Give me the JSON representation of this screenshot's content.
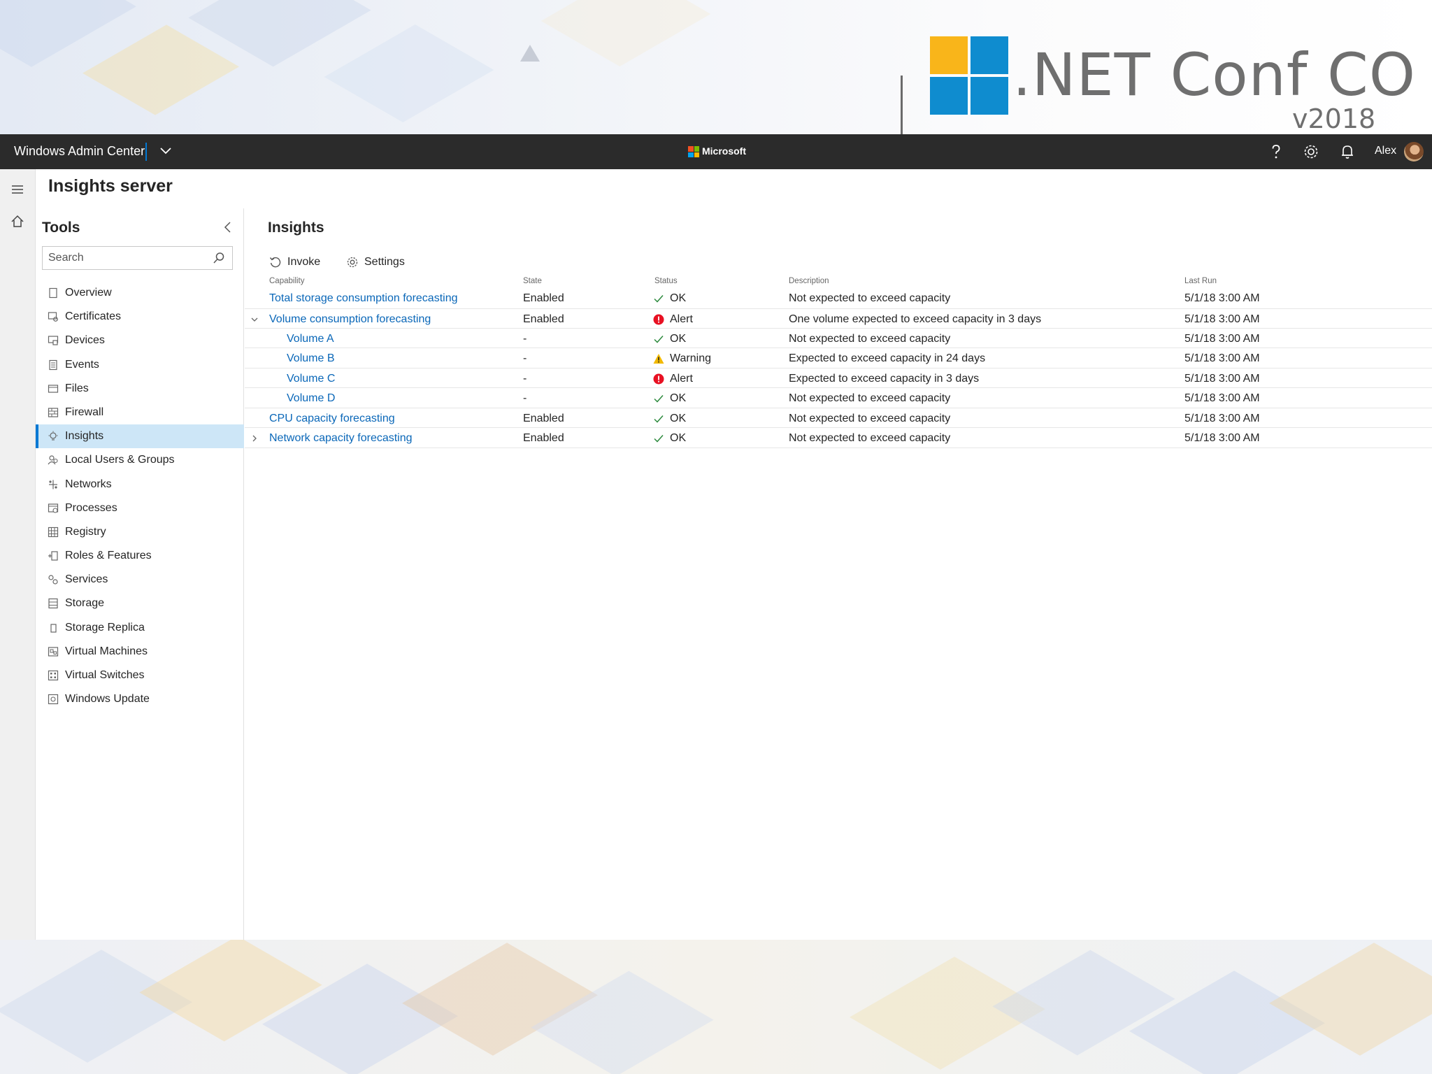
{
  "conference": {
    "title": ".NET Conf CO",
    "version": "v2018"
  },
  "topbar": {
    "app_title": "Windows Admin Center",
    "brand": "Microsoft",
    "user": "Alex",
    "icons": [
      "chevron-down-icon",
      "help-icon",
      "gear-icon",
      "bell-icon",
      "avatar"
    ]
  },
  "server": {
    "title": "Insights server"
  },
  "tools": {
    "title": "Tools",
    "search_placeholder": "Search",
    "items": [
      {
        "label": "Overview",
        "icon": "overview-icon"
      },
      {
        "label": "Certificates",
        "icon": "certificates-icon"
      },
      {
        "label": "Devices",
        "icon": "devices-icon"
      },
      {
        "label": "Events",
        "icon": "events-icon"
      },
      {
        "label": "Files",
        "icon": "files-icon"
      },
      {
        "label": "Firewall",
        "icon": "firewall-icon"
      },
      {
        "label": "Insights",
        "icon": "insights-icon",
        "active": true
      },
      {
        "label": "Local Users & Groups",
        "icon": "users-icon"
      },
      {
        "label": "Networks",
        "icon": "networks-icon"
      },
      {
        "label": "Processes",
        "icon": "processes-icon"
      },
      {
        "label": "Registry",
        "icon": "registry-icon"
      },
      {
        "label": "Roles & Features",
        "icon": "roles-icon"
      },
      {
        "label": "Services",
        "icon": "services-icon"
      },
      {
        "label": "Storage",
        "icon": "storage-icon"
      },
      {
        "label": "Storage Replica",
        "icon": "storage-replica-icon"
      },
      {
        "label": "Virtual Machines",
        "icon": "virtual-machines-icon"
      },
      {
        "label": "Virtual Switches",
        "icon": "virtual-switches-icon"
      },
      {
        "label": "Windows Update",
        "icon": "windows-update-icon"
      }
    ]
  },
  "insights": {
    "title": "Insights",
    "commands": {
      "invoke": "Invoke",
      "settings": "Settings"
    },
    "columns": {
      "capability": "Capability",
      "state": "State",
      "status": "Status",
      "description": "Description",
      "last_run": "Last Run"
    },
    "rows": [
      {
        "capability": "Total storage consumption forecasting",
        "state": "Enabled",
        "status": "OK",
        "status_kind": "ok",
        "description": "Not expected to exceed capacity",
        "last_run": "5/1/18 3:00 AM",
        "level": 0,
        "expander": "none"
      },
      {
        "capability": "Volume consumption forecasting",
        "state": "Enabled",
        "status": "Alert",
        "status_kind": "alert",
        "description": "One volume expected to exceed capacity in 3 days",
        "last_run": "5/1/18 3:00 AM",
        "level": 0,
        "expander": "expanded"
      },
      {
        "capability": "Volume A",
        "state": "-",
        "status": "OK",
        "status_kind": "ok",
        "description": "Not expected to exceed capacity",
        "last_run": "5/1/18 3:00 AM",
        "level": 1,
        "expander": "none"
      },
      {
        "capability": "Volume B",
        "state": "-",
        "status": "Warning",
        "status_kind": "warning",
        "description": "Expected to exceed capacity in 24 days",
        "last_run": "5/1/18 3:00 AM",
        "level": 1,
        "expander": "none"
      },
      {
        "capability": "Volume C",
        "state": "-",
        "status": "Alert",
        "status_kind": "alert",
        "description": "Expected to exceed capacity in 3 days",
        "last_run": "5/1/18 3:00 AM",
        "level": 1,
        "expander": "none"
      },
      {
        "capability": "Volume D",
        "state": "-",
        "status": "OK",
        "status_kind": "ok",
        "description": "Not expected to exceed capacity",
        "last_run": "5/1/18 3:00 AM",
        "level": 1,
        "expander": "none"
      },
      {
        "capability": "CPU capacity forecasting",
        "state": "Enabled",
        "status": "OK",
        "status_kind": "ok",
        "description": "Not expected to exceed capacity",
        "last_run": "5/1/18 3:00 AM",
        "level": 0,
        "expander": "none"
      },
      {
        "capability": "Network capacity forecasting",
        "state": "Enabled",
        "status": "OK",
        "status_kind": "ok",
        "description": "Not expected to exceed capacity",
        "last_run": "5/1/18 3:00 AM",
        "level": 0,
        "expander": "collapsed"
      }
    ]
  },
  "colors": {
    "topbar": "#2b2b2b",
    "accent": "#0078d4",
    "link": "#0a67b8",
    "active_item": "#cde6f7",
    "ok": "#2d8a3e",
    "alert": "#e81123",
    "warning": "#f2b900"
  }
}
